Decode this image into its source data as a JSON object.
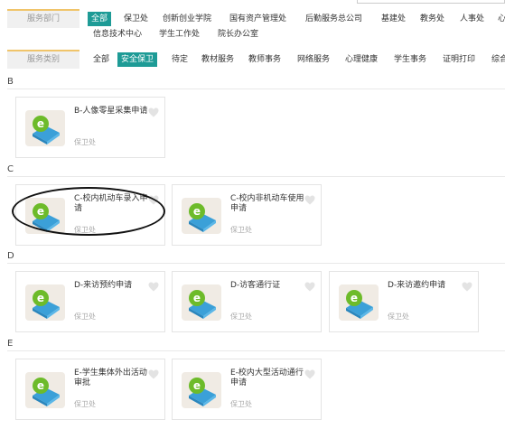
{
  "service_dept": {
    "label": "服务部门",
    "options": [
      "全部",
      "保卫处",
      "创新创业学院",
      "国有资产管理处",
      "后勤服务总公司",
      "基建处",
      "教务处",
      "人事处",
      "心",
      "信息技术中心",
      "学生工作处",
      "院长办公室"
    ]
  },
  "service_type": {
    "label": "服务类别",
    "options": [
      "全部",
      "安全保卫",
      "待定",
      "教材服务",
      "教师事务",
      "网络服务",
      "心理健康",
      "学生事务",
      "证明打印",
      "综合"
    ]
  },
  "sections": [
    {
      "letter": "B",
      "cards": [
        {
          "title": "B-人像零星采集申请",
          "dept": "保卫处"
        }
      ]
    },
    {
      "letter": "C",
      "cards": [
        {
          "title": "C-校内机动车录入申请",
          "dept": "保卫处"
        },
        {
          "title": "C-校内非机动车使用申请",
          "dept": "保卫处"
        }
      ]
    },
    {
      "letter": "D",
      "cards": [
        {
          "title": "D-来访预约申请",
          "dept": "保卫处"
        },
        {
          "title": "D-访客通行证",
          "dept": "保卫处"
        },
        {
          "title": "D-来访邀约申请",
          "dept": "保卫处"
        }
      ]
    },
    {
      "letter": "E",
      "cards": [
        {
          "title": "E-学生集体外出活动审批",
          "dept": "保卫处"
        },
        {
          "title": "E-校内大型活动通行申请",
          "dept": "保卫处"
        }
      ]
    }
  ],
  "colors": {
    "accent": "#1e9b96",
    "label_border": "#f0c46a",
    "icon_green": "#6dbb2a",
    "icon_blue": "#3ba0d8"
  },
  "icons": {
    "card": "app-icon",
    "favorite": "heart-icon"
  }
}
